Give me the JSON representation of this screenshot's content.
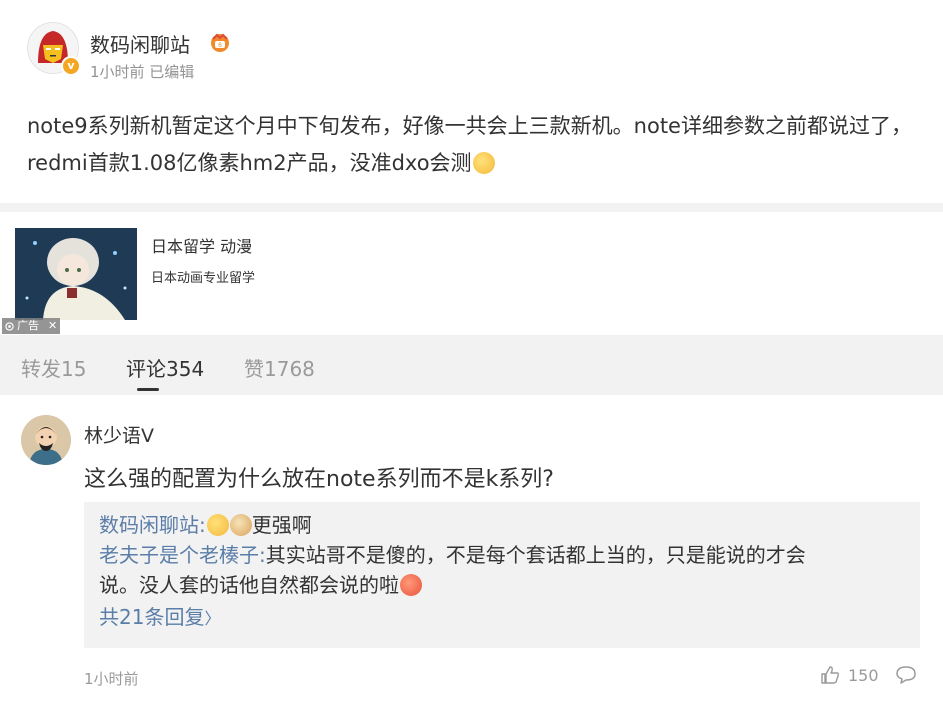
{
  "post": {
    "author": "数码闲聊站",
    "meta": "1小时前 已编辑",
    "text": "note9系列新机暂定这个月中下旬发布，好像一共会上三款新机。note详细参数之前都说过了，redmi首款1.08亿像素hm2产品，没准dxo会测"
  },
  "ad": {
    "title": "日本留学 动漫",
    "subtitle": "日本动画专业留学",
    "tag": "广告"
  },
  "tabs": [
    {
      "label": "转发15"
    },
    {
      "label": "评论354"
    },
    {
      "label": "赞1768"
    }
  ],
  "comment": {
    "user": "林少语V",
    "text": "这么强的配置为什么放在note系列而不是k系列?",
    "replies": [
      {
        "user": "数码闲聊站",
        "sep": ":",
        "text": "更强啊"
      },
      {
        "user": "老夫子是个老楱子",
        "sep": ":",
        "text": "其实站哥不是傻的，不是每个套话都上当的，只是能说的才会",
        "text2": "说。没人套的话他自然都会说的啦"
      }
    ],
    "more": "共21条回复",
    "more_chevron": "〉",
    "time": "1小时前",
    "likes": "150"
  },
  "icons": {
    "vbadge": "v",
    "close": "✕"
  },
  "colors": {
    "link": "#5b7ea8",
    "badge": "#f5a623",
    "background": "#f2f2f2"
  }
}
